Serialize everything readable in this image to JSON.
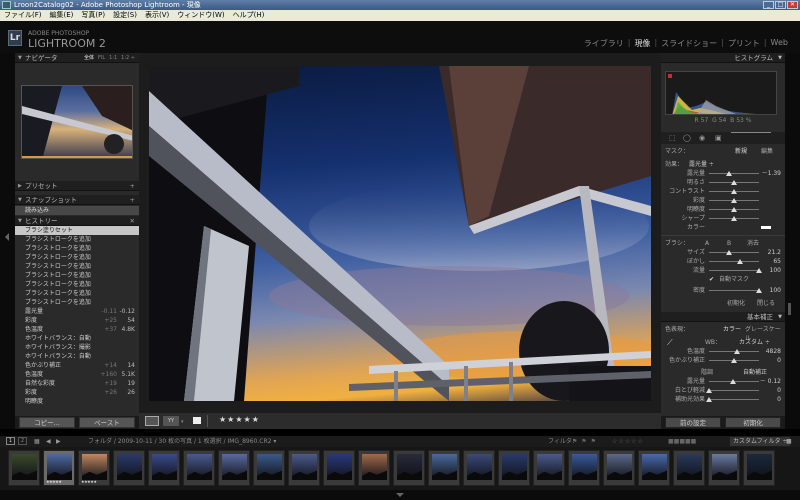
{
  "window": {
    "title": "Lroon2Catalog02 - Adobe Photoshop Lightroom - 現像"
  },
  "menu": [
    "ファイル(F)",
    "編集(E)",
    "写真(P)",
    "設定(S)",
    "表示(V)",
    "ウィンドウ(W)",
    "ヘルプ(H)"
  ],
  "brand": {
    "line1": "ADOBE PHOTOSHOP",
    "line2": "LIGHTROOM 2",
    "logo": "Lr"
  },
  "modules": [
    "ライブラリ",
    "現像",
    "スライドショー",
    "プリント",
    "Web"
  ],
  "active_module": "現像",
  "left": {
    "navigator": {
      "title": "ナビゲータ",
      "zoom": [
        "全体",
        "FIL",
        "1:1",
        "1:2 ÷"
      ]
    },
    "presets": "プリセット",
    "snapshots": "スナップショット",
    "snapshot_item": "読み込み",
    "history": "ヒストリー",
    "history_items": [
      {
        "label": "ブラシ塗りセット",
        "selected": true
      },
      {
        "label": "ブラシストロークを追加"
      },
      {
        "label": "ブラシストロークを追加"
      },
      {
        "label": "ブラシストロークを追加"
      },
      {
        "label": "ブラシストロークを追加"
      },
      {
        "label": "ブラシストロークを追加"
      },
      {
        "label": "ブラシストロークを追加"
      },
      {
        "label": "ブラシストロークを追加"
      },
      {
        "label": "ブラシストロークを追加"
      },
      {
        "label": "露光量",
        "v1": "-0.11",
        "v2": "-0.12"
      },
      {
        "label": "彩度",
        "v1": "+25",
        "v2": "54"
      },
      {
        "label": "色温度",
        "v1": "+37",
        "v2": "4.8K"
      },
      {
        "label": "ホワイトバランス：自動"
      },
      {
        "label": "ホワイトバランス：撮影"
      },
      {
        "label": "ホワイトバランス：自動"
      },
      {
        "label": "色かぶり補正",
        "v1": "+14",
        "v2": "14"
      },
      {
        "label": "色温度",
        "v1": "+160",
        "v2": "5.1K"
      },
      {
        "label": "自然な彩度",
        "v1": "+19",
        "v2": "19"
      },
      {
        "label": "彩度",
        "v1": "+26",
        "v2": "26"
      },
      {
        "label": "明瞭度"
      }
    ],
    "copy": "コピー...",
    "paste": "ペースト"
  },
  "right": {
    "histogram_title": "ヒストグラム",
    "rgb": {
      "r_label": "R",
      "r": "57",
      "g_label": "G",
      "g": "54",
      "b_label": "B",
      "b": "53 %"
    },
    "mask": {
      "label": "マスク：",
      "new": "新規",
      "edit": "編集"
    },
    "effect": {
      "label": "効果：",
      "value": "露光量 ÷"
    },
    "sliders": [
      {
        "label": "露光量",
        "value": "－1.39",
        "pos": 0.4
      },
      {
        "label": "明るさ",
        "value": "",
        "pos": 0.5
      },
      {
        "label": "コントラスト",
        "value": "",
        "pos": 0.5
      },
      {
        "label": "彩度",
        "value": "",
        "pos": 0.5
      },
      {
        "label": "明瞭度",
        "value": "",
        "pos": 0.5
      },
      {
        "label": "シャープ",
        "value": "",
        "pos": 0.5
      }
    ],
    "color_label": "カラー",
    "brush": {
      "label": "ブラシ：",
      "a": "A",
      "b": "B",
      "erase": "消去"
    },
    "brush_sliders": [
      {
        "label": "サイズ",
        "value": "21.2",
        "pos": 0.4
      },
      {
        "label": "ぼかし",
        "value": "65",
        "pos": 0.62
      },
      {
        "label": "流量",
        "value": "100",
        "pos": 1.0
      }
    ],
    "auto_mask": "自動マスク",
    "density": {
      "label": "密度",
      "value": "100",
      "pos": 1.0
    },
    "reset_btn": "初期化",
    "close_btn": "閉じる",
    "basic_title": "基本補正",
    "treatment": {
      "label": "色表現：",
      "color": "カラー",
      "gray": "グレースケール"
    },
    "wb": {
      "label": "WB：",
      "value": "カスタム ÷"
    },
    "wb_sliders": [
      {
        "label": "色温度",
        "value": "4828",
        "pos": 0.55
      },
      {
        "label": "色かぶり補正",
        "value": "0",
        "pos": 0.5
      }
    ],
    "tone": {
      "label": "階調",
      "auto": "自動補正"
    },
    "tone_sliders": [
      {
        "label": "露光量",
        "value": "－ 0.12",
        "pos": 0.47
      },
      {
        "label": "白とび軽減",
        "value": "0",
        "pos": 0.0
      },
      {
        "label": "補助光効果",
        "value": "0",
        "pos": 0.0
      }
    ],
    "prev_btn": "前の設定",
    "init_btn": "初期化"
  },
  "toolbar": {
    "stars": "★★★★★"
  },
  "filmstrip": {
    "pages": [
      "1",
      "2"
    ],
    "path": "フォルダ / 2009-10-11 / 30 枚の写真 / 1 枚選択 / IMG_8960.CR2 ▾",
    "filter_label": "フィルタ：",
    "custom_filter": "カスタムフィルタ ÷",
    "thumbs": [
      {
        "stars": "",
        "tone": "#3a4a2a"
      },
      {
        "stars": "★★★★★",
        "tone": "#4e6aa0"
      },
      {
        "stars": "★★★★★",
        "tone": "#c08860"
      },
      {
        "stars": "",
        "tone": "#2a3a6a"
      },
      {
        "stars": "",
        "tone": "#3a4a8a"
      },
      {
        "stars": "",
        "tone": "#4a5a90"
      },
      {
        "stars": "",
        "tone": "#5a6aa0"
      },
      {
        "stars": "",
        "tone": "#3a5a8a"
      },
      {
        "stars": "",
        "tone": "#4a5a8a"
      },
      {
        "stars": "",
        "tone": "#2a3a7a"
      },
      {
        "stars": "",
        "tone": "#a06a4a"
      },
      {
        "stars": "",
        "tone": "#2a2a3a"
      },
      {
        "stars": "",
        "tone": "#4a6a9a"
      },
      {
        "stars": "",
        "tone": "#3a4a7a"
      },
      {
        "stars": "",
        "tone": "#2a3a6a"
      },
      {
        "stars": "",
        "tone": "#4a5a8a"
      },
      {
        "stars": "",
        "tone": "#3a5a9a"
      },
      {
        "stars": "",
        "tone": "#5a6a8a"
      },
      {
        "stars": "",
        "tone": "#4a6aaa"
      },
      {
        "stars": "",
        "tone": "#2a3a5a"
      },
      {
        "stars": "",
        "tone": "#6a7aa0"
      },
      {
        "stars": "",
        "tone": "#1a2a3a"
      }
    ]
  }
}
